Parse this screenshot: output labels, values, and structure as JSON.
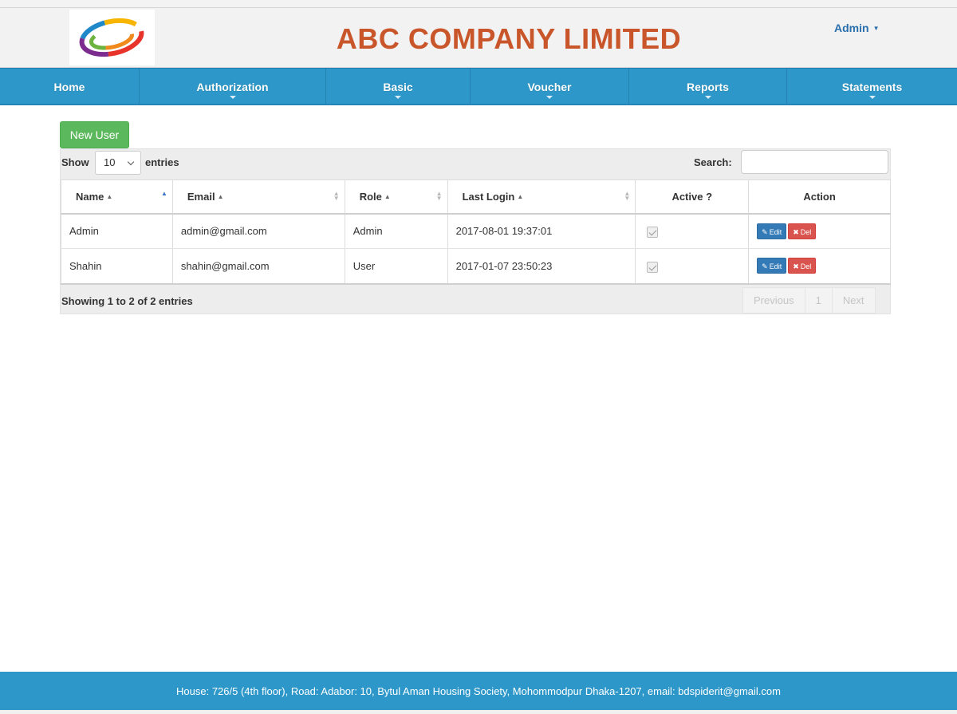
{
  "header": {
    "company_title": "ABC COMPANY LIMITED",
    "user_menu": "Admin",
    "logo": "swirl-logo"
  },
  "nav": {
    "items": [
      {
        "label": "Home",
        "dropdown": false
      },
      {
        "label": "Authorization",
        "dropdown": true
      },
      {
        "label": "Basic",
        "dropdown": true
      },
      {
        "label": "Voucher",
        "dropdown": true
      },
      {
        "label": "Reports",
        "dropdown": true
      },
      {
        "label": "Statements",
        "dropdown": true
      }
    ]
  },
  "toolbar": {
    "new_user_label": "New User"
  },
  "table_controls": {
    "show_label": "Show",
    "page_length": "10",
    "entries_label": "entries",
    "search_label": "Search:",
    "search_value": ""
  },
  "table": {
    "columns": [
      "Name",
      "Email",
      "Role",
      "Last Login",
      "Active ?",
      "Action"
    ],
    "rows": [
      {
        "name": "Admin",
        "email": "admin@gmail.com",
        "role": "Admin",
        "last_login": "2017-08-01 19:37:01",
        "active": true
      },
      {
        "name": "Shahin",
        "email": "shahin@gmail.com",
        "role": "User",
        "last_login": "2017-01-07 23:50:23",
        "active": true
      }
    ],
    "edit_label": "Edit",
    "del_label": "Del"
  },
  "pagination": {
    "info": "Showing 1 to 2 of 2 entries",
    "previous": "Previous",
    "page": "1",
    "next": "Next"
  },
  "footer": {
    "text": "House: 726/5 (4th floor), Road: Adabor: 10, Bytul Aman Housing Society, Mohommodpur Dhaka-1207, email: bdspiderit@gmail.com"
  },
  "colors": {
    "navbar": "#2c97c8",
    "title": "#c9562b",
    "new_user_button": "#5cb85c",
    "edit_button": "#337ab7",
    "del_button": "#d9534f"
  }
}
